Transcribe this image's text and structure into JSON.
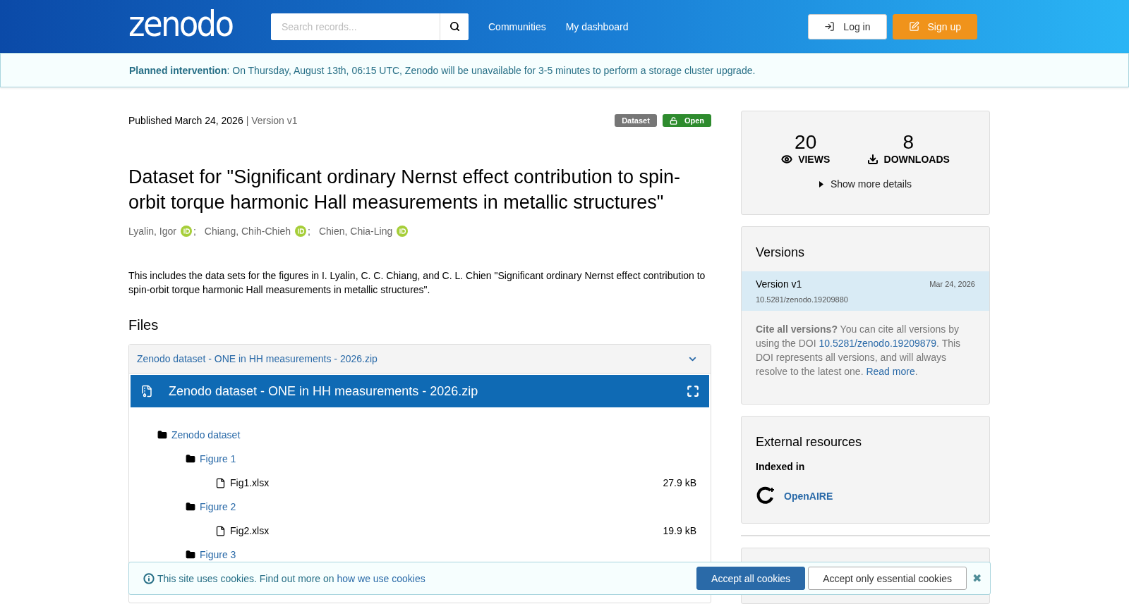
{
  "header": {
    "logo": "zenodo",
    "search": {
      "placeholder": "Search records..."
    },
    "nav": [
      "Communities",
      "My dashboard"
    ],
    "login": "Log in",
    "signup": "Sign up"
  },
  "banner": {
    "text": "**Planned intervention**: On Thursday, August 13th, 06:15 UTC, Zenodo will be unavailable for 3-5 minutes to perform a storage cluster upgrade."
  },
  "record": {
    "published": "Published March 24, 2026",
    "version": "| Version v1",
    "badges": [
      {
        "label": "Dataset",
        "kind": "type"
      },
      {
        "label": "Open",
        "kind": "access"
      }
    ],
    "title": "Dataset for \"Significant ordinary Nernst effect contribution to spin-orbit torque harmonic Hall measurements in metallic structures\"",
    "authors": [
      {
        "name": "Lyalin, Igor",
        "separator": ";"
      },
      {
        "name": "Chiang, Chih-Chieh",
        "separator": ";"
      },
      {
        "name": "Chien, Chia-Ling"
      }
    ],
    "description": "This includes the data sets for the figures in I. Lyalin, C. C. Chiang, and C. L. Chien \"Significant ordinary Nernst effect contribution to spin-orbit torque harmonic Hall measurements in metallic structures\"."
  },
  "files": {
    "heading": "Files",
    "accordion": {
      "title": "Zenodo dataset - ONE in HH measurements - 2026.zip",
      "expanded": true
    },
    "preview_title": "Zenodo dataset - ONE in HH measurements - 2026.zip",
    "tree": [
      {
        "kind": "folder",
        "name": "Zenodo dataset",
        "children": [
          {
            "kind": "folder",
            "name": "Figure 1",
            "children": [
              {
                "kind": "file",
                "name": "Fig1.xlsx",
                "size": "27.9 kB"
              }
            ]
          },
          {
            "kind": "folder",
            "name": "Figure 2",
            "children": [
              {
                "kind": "file",
                "name": "Fig2.xlsx",
                "size": "19.9 kB"
              }
            ]
          },
          {
            "kind": "folder",
            "name": "Figure 3"
          }
        ]
      }
    ]
  },
  "sidebar": {
    "stats": [
      {
        "value": "20",
        "label": "VIEWS",
        "kind": "views"
      },
      {
        "value": "8",
        "label": "DOWNLOADS",
        "kind": "downloads"
      }
    ],
    "details_toggle": {
      "label": "Show more details",
      "expanded": false
    },
    "versions": {
      "heading": "Versions",
      "items": [
        {
          "label": "Version v1",
          "date": "Mar 24, 2026",
          "doi": "10.5281/zenodo.19209880",
          "selected": true
        }
      ],
      "cite": {
        "lead": "Cite all versions?",
        "text1": "You can cite all versions by using the DOI",
        "doi": "10.5281/zenodo.19209879",
        "text2": ". This DOI represents all versions, and will always resolve to the latest one.",
        "link": "Read more",
        "end": "."
      }
    },
    "external": {
      "heading": "External resources",
      "subheading": "Indexed in",
      "items": [
        "OpenAIRE"
      ]
    }
  },
  "cookies": {
    "text": "This site uses cookies. Find out more on",
    "link": "how we use cookies",
    "accept_all": "Accept all cookies",
    "accept_essential": "Accept only essential cookies",
    "close": "✖"
  }
}
